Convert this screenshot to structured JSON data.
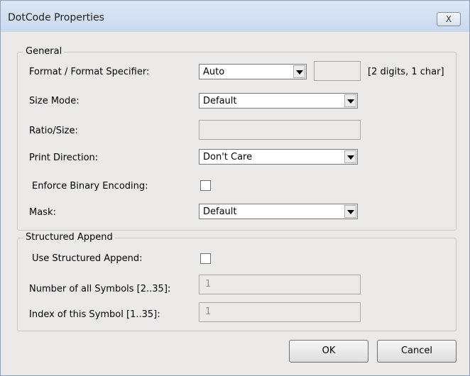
{
  "window": {
    "title": "DotCode Properties",
    "close_label": "X"
  },
  "general": {
    "legend": "General",
    "format": {
      "label": "Format / Format Specifier:",
      "value": "Auto",
      "specifier_value": "",
      "hint": "[2 digits, 1 char]"
    },
    "size_mode": {
      "label": "Size Mode:",
      "value": "Default"
    },
    "ratio_size": {
      "label": "Ratio/Size:",
      "value": ""
    },
    "print_direction": {
      "label": "Print Direction:",
      "value": "Don't Care"
    },
    "enforce_binary": {
      "label": "Enforce Binary Encoding:",
      "checked": false
    },
    "mask": {
      "label": "Mask:",
      "value": "Default"
    }
  },
  "structured_append": {
    "legend": "Structured Append",
    "use": {
      "label": "Use Structured Append:",
      "checked": false
    },
    "number_of_symbols": {
      "label": "Number of all Symbols [2..35]:",
      "value": "1"
    },
    "index_of_symbol": {
      "label": "Index of this Symbol [1..35]:",
      "value": "1"
    }
  },
  "buttons": {
    "ok": "OK",
    "cancel": "Cancel"
  }
}
